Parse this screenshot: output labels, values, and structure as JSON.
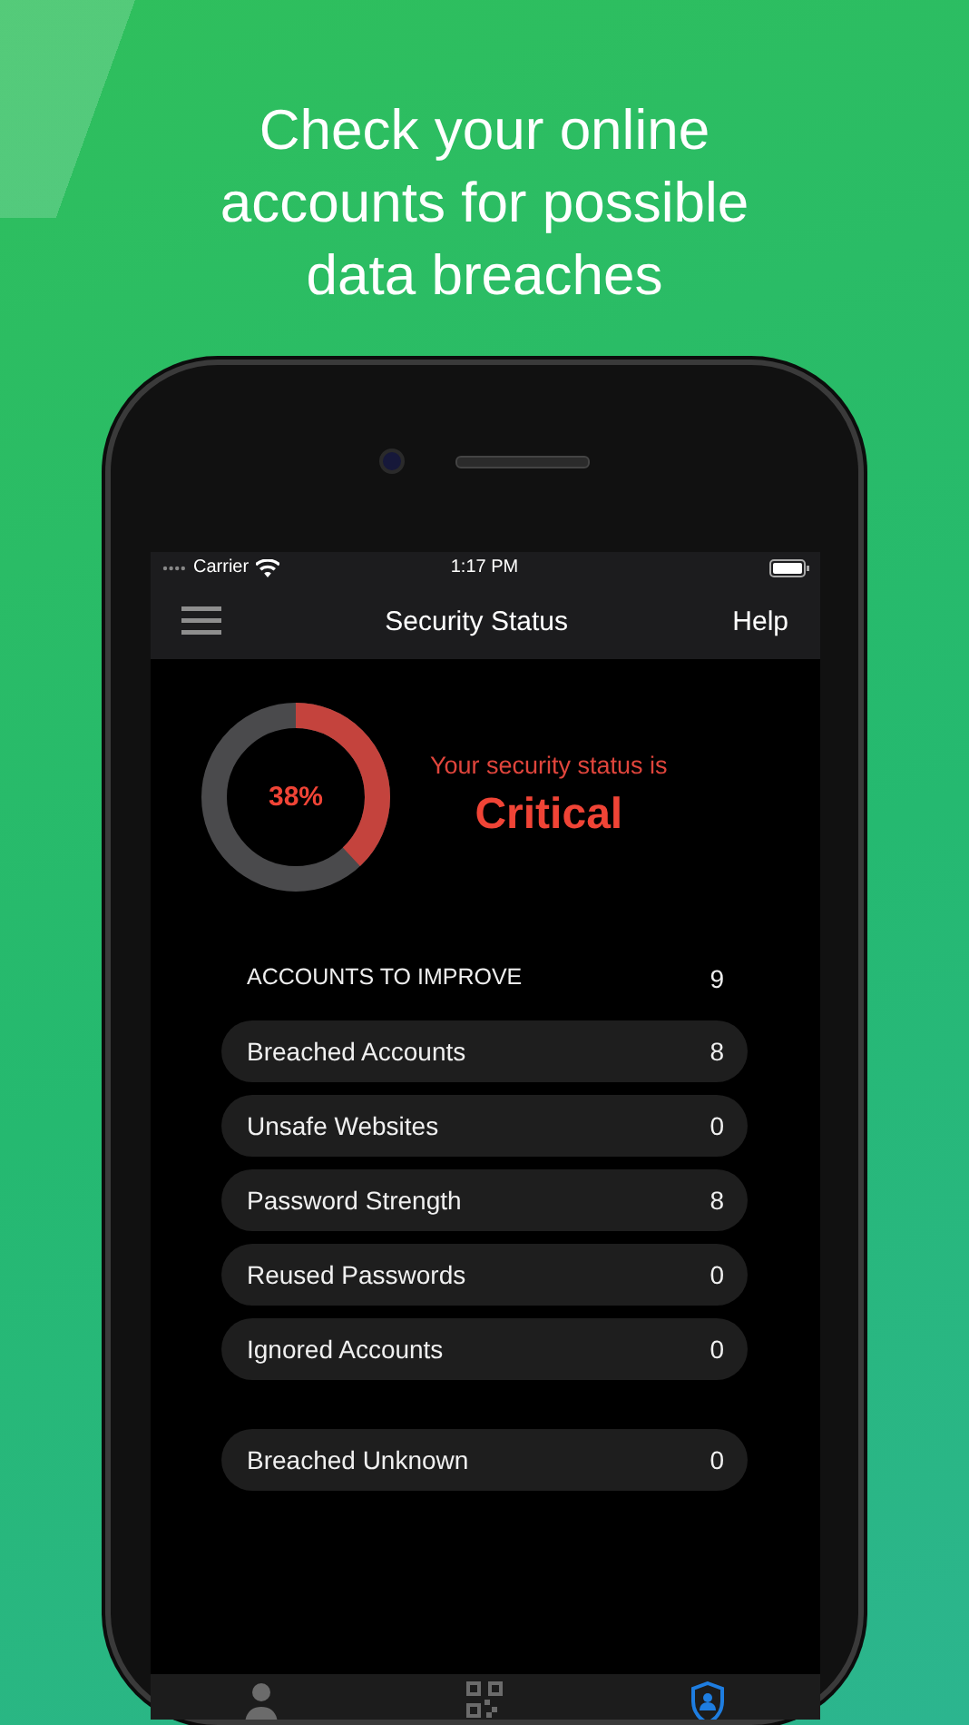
{
  "headline": "Check your online accounts for possible data breaches",
  "status_bar": {
    "carrier": "Carrier",
    "time": "1:17 PM"
  },
  "nav_bar": {
    "title": "Security Status",
    "action": "Help"
  },
  "gauge": {
    "level": 0.38,
    "reading": "38%"
  },
  "status": {
    "caption": "Your security status is",
    "value": "Critical"
  },
  "summary": {
    "label": "ACCOUNTS TO IMPROVE",
    "count": "9"
  },
  "groups": [
    [
      {
        "label": "Breached Accounts",
        "count": "8"
      },
      {
        "label": "Unsafe Websites",
        "count": "0"
      },
      {
        "label": "Password Strength",
        "count": "8"
      },
      {
        "label": "Reused Passwords",
        "count": "0"
      },
      {
        "label": "Ignored Accounts",
        "count": "0"
      }
    ],
    [
      {
        "label": "Breached Unknown",
        "count": "0"
      }
    ]
  ],
  "tabs": [
    {
      "kind": "person",
      "selected": false
    },
    {
      "kind": "qr",
      "selected": false
    },
    {
      "kind": "shield",
      "selected": true
    }
  ]
}
